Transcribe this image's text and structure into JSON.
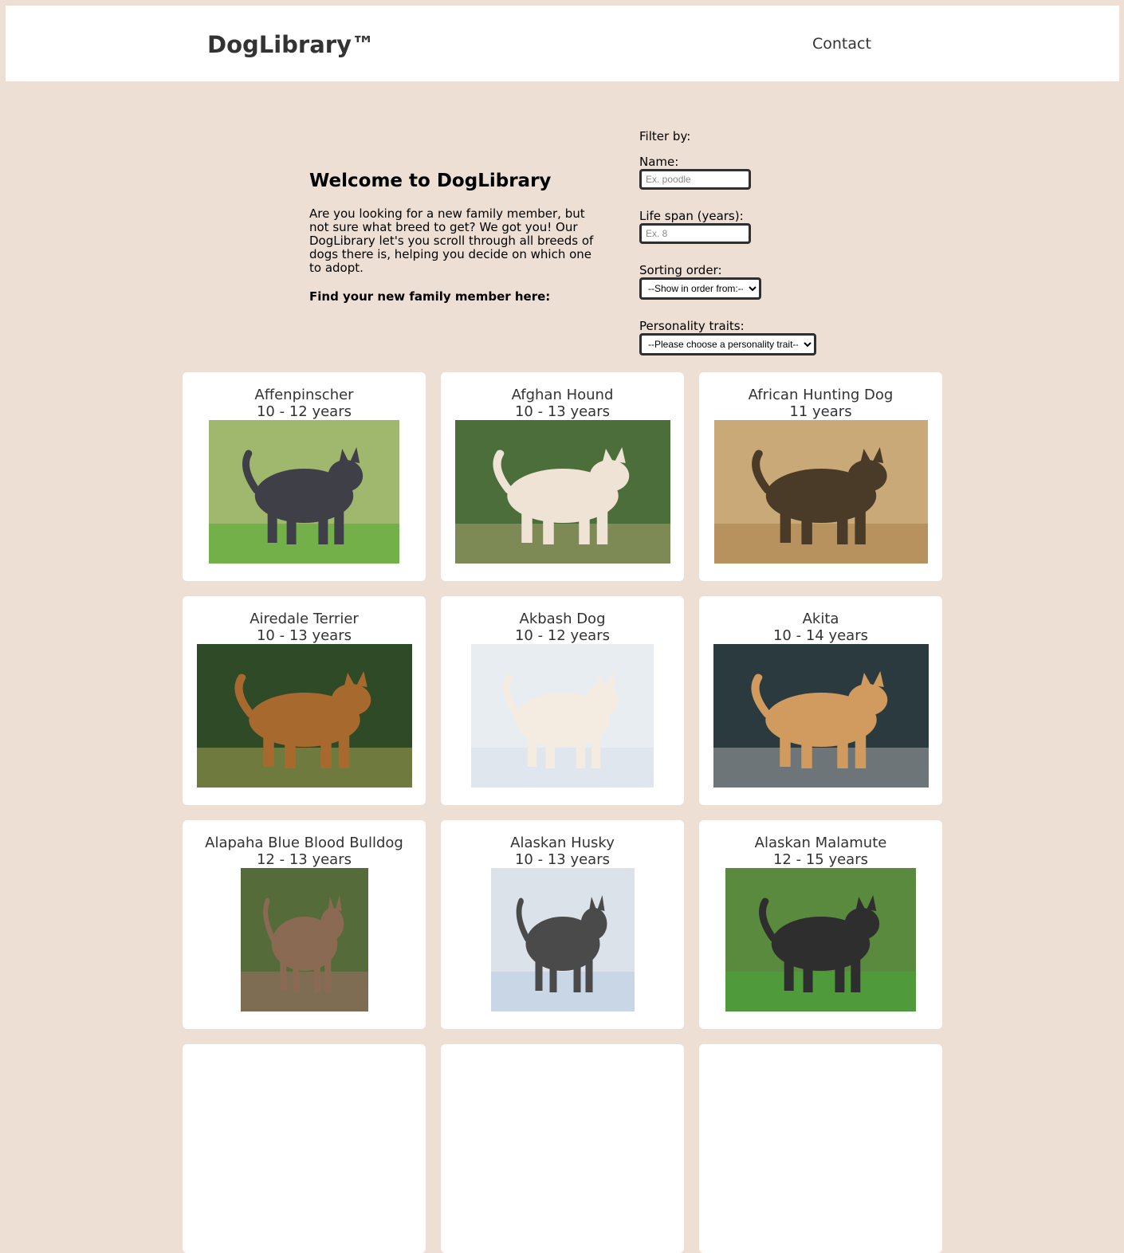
{
  "header": {
    "logo": "DogLibrary™",
    "contact": "Contact"
  },
  "intro": {
    "title": "Welcome to DogLibrary",
    "body": "Are you looking for a new family member, but not sure what breed to get? We got you! Our DogLibrary let's you scroll through all breeds of dogs there is, helping you decide on which one to adopt.",
    "cta": "Find your new family member here:"
  },
  "filters": {
    "title": "Filter by:",
    "name_label": "Name:",
    "name_placeholder": "Ex. poodle",
    "life_label": "Life span (years):",
    "life_placeholder": "Ex. 8",
    "sort_label": "Sorting order:",
    "sort_selected": "--Show in order from:--",
    "trait_label": "Personality traits:",
    "trait_selected": "--Please choose a personality trait--"
  },
  "dogs": [
    {
      "name": "Affenpinscher",
      "life": "10 - 12 years",
      "bg": "#9fb86e",
      "fur": "#3f3f48",
      "ground": "#74b04a"
    },
    {
      "name": "Afghan Hound",
      "life": "10 - 13 years",
      "bg": "#4c6e3a",
      "fur": "#efe3d6",
      "ground": "#7d8a56"
    },
    {
      "name": "African Hunting Dog",
      "life": "11 years",
      "bg": "#c9a978",
      "fur": "#4a3a28",
      "ground": "#b8925e"
    },
    {
      "name": "Airedale Terrier",
      "life": "10 - 13 years",
      "bg": "#2f4a26",
      "fur": "#a8692e",
      "ground": "#6f7a3f"
    },
    {
      "name": "Akbash Dog",
      "life": "10 - 12 years",
      "bg": "#e8edf2",
      "fur": "#f4ece0",
      "ground": "#dfe6ee"
    },
    {
      "name": "Akita",
      "life": "10 - 14 years",
      "bg": "#2b3a3e",
      "fur": "#d19a5e",
      "ground": "#6d7578"
    },
    {
      "name": "Alapaha Blue Blood Bulldog",
      "life": "12 - 13 years",
      "bg": "#556b3a",
      "fur": "#8a6a52",
      "ground": "#7e6d52"
    },
    {
      "name": "Alaskan Husky",
      "life": "10 - 13 years",
      "bg": "#dbe2ea",
      "fur": "#4a4a4a",
      "ground": "#c9d6e6"
    },
    {
      "name": "Alaskan Malamute",
      "life": "12 - 15 years",
      "bg": "#5a8a3e",
      "fur": "#2e2e2e",
      "ground": "#4f9a3a"
    }
  ]
}
